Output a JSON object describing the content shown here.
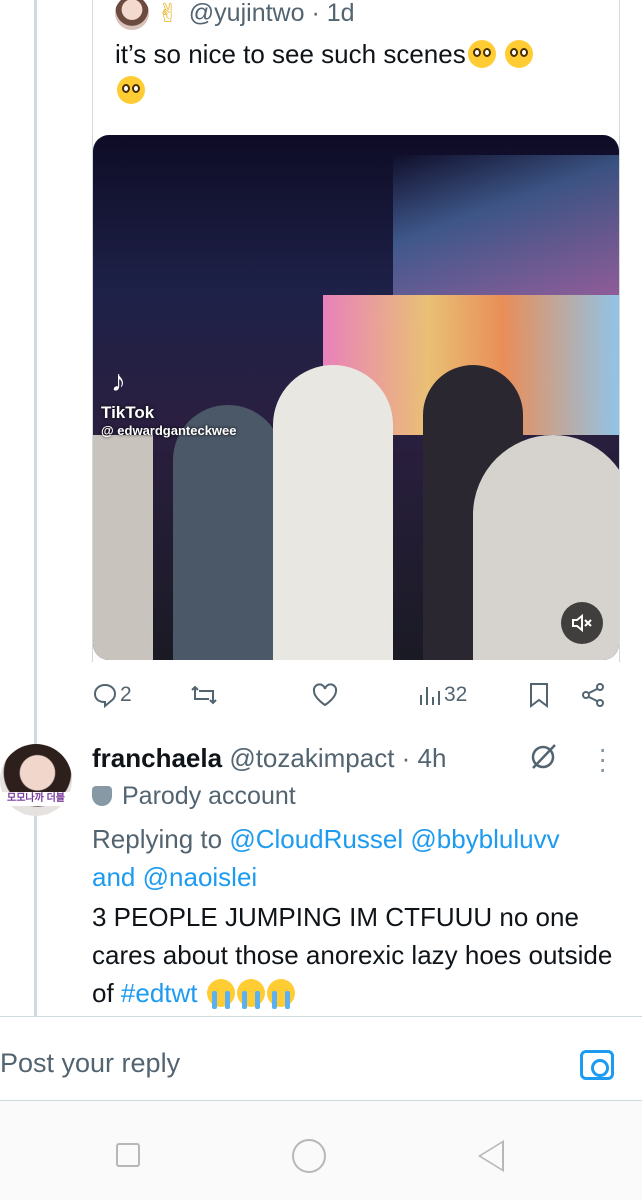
{
  "quoted_tweet": {
    "handle": "@yujintwo",
    "time": "· 1d",
    "text": "it’s so nice to see such scenes",
    "media": {
      "watermark_app": "TikTok",
      "watermark_user": "@ edwardganteckwee"
    },
    "actions": {
      "replies": "2",
      "views": "32"
    }
  },
  "reply": {
    "display_name": "franchaela",
    "handle": "@tozakimpact",
    "time": "· 4h",
    "avatar_caption": "모모나까 더블",
    "badge": "Parody account",
    "replying_prefix": "Replying to",
    "mentions": [
      "@CloudRussel",
      "@bbybluluvv",
      "@naoislei"
    ],
    "and_word": "and",
    "text": "3 PEOPLE JUMPING IM CTFUUU no one cares about those anorexic lazy hoes outside of",
    "hashtag": "#edtwt"
  },
  "composer": {
    "placeholder": "Post your reply"
  },
  "colors": {
    "accent": "#1d9bf0",
    "secondary_text": "#536471"
  },
  "icons": [
    "peace-hand-icon",
    "pleading-face-icon",
    "crying-face-icon",
    "mute-icon",
    "reply-icon",
    "retweet-icon",
    "like-icon",
    "views-icon",
    "bookmark-icon",
    "share-icon",
    "grok-icon",
    "more-icon",
    "camera-icon"
  ]
}
